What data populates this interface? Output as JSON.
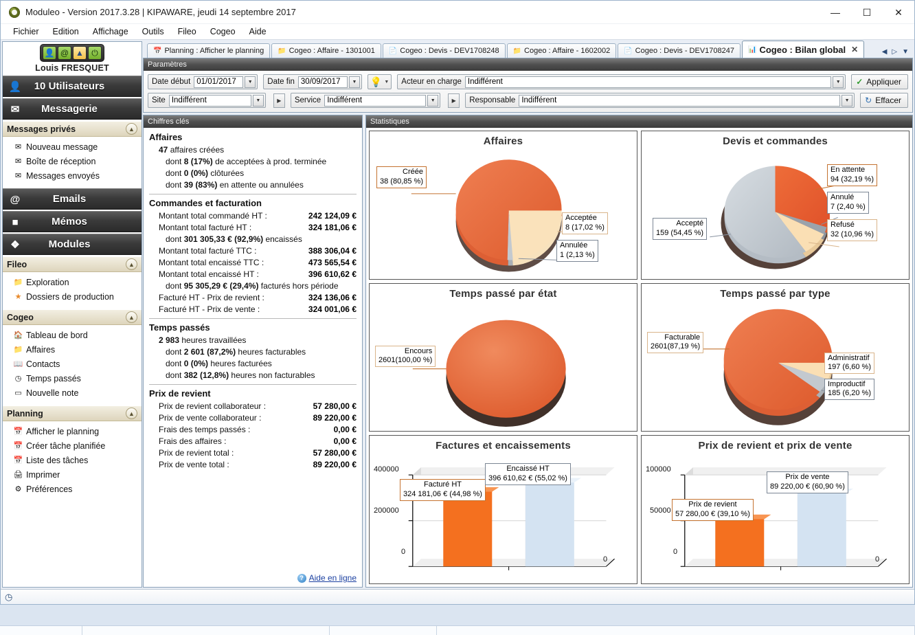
{
  "window": {
    "title": "Moduleo - Version 2017.3.28 | KIPAWARE, jeudi 14 septembre 2017",
    "minimize": "—",
    "maximize": "☐",
    "close": "✕"
  },
  "menu": [
    "Fichier",
    "Edition",
    "Affichage",
    "Outils",
    "Fileo",
    "Cogeo",
    "Aide"
  ],
  "sidebar": {
    "user_name": "Louis FRESQUET",
    "quick_icons": [
      "user-icon",
      "at-icon",
      "map-icon",
      "power-icon"
    ],
    "bars": [
      {
        "label": "10 Utilisateurs",
        "icon": "users-icon"
      },
      {
        "label": "Messagerie",
        "icon": "envelope-icon"
      },
      {
        "label": "Emails",
        "icon": "at-envelope-icon"
      },
      {
        "label": "Mémos",
        "icon": "note-icon"
      },
      {
        "label": "Modules",
        "icon": "modules-icon"
      }
    ],
    "groups": [
      {
        "title": "Messages privés",
        "items": [
          {
            "label": "Nouveau message",
            "icon": "new-message-icon"
          },
          {
            "label": "Boîte de réception",
            "icon": "inbox-icon"
          },
          {
            "label": "Messages envoyés",
            "icon": "sent-icon"
          }
        ]
      },
      {
        "title": "Fileo",
        "items": [
          {
            "label": "Exploration",
            "icon": "folder-explore-icon"
          },
          {
            "label": "Dossiers de production",
            "icon": "star-icon"
          }
        ]
      },
      {
        "title": "Cogeo",
        "items": [
          {
            "label": "Tableau de bord",
            "icon": "home-icon"
          },
          {
            "label": "Affaires",
            "icon": "folder-icon"
          },
          {
            "label": "Contacts",
            "icon": "contacts-icon"
          },
          {
            "label": "Temps passés",
            "icon": "clock-icon"
          },
          {
            "label": "Nouvelle note",
            "icon": "new-note-icon"
          }
        ]
      },
      {
        "title": "Planning",
        "items": [
          {
            "label": "Afficher le planning",
            "icon": "calendar-icon"
          },
          {
            "label": "Créer tâche planifiée",
            "icon": "calendar-add-icon"
          },
          {
            "label": "Liste des tâches",
            "icon": "calendar-list-icon"
          },
          {
            "label": "Imprimer",
            "icon": "printer-icon"
          },
          {
            "label": "Préférences",
            "icon": "preferences-icon"
          }
        ]
      }
    ]
  },
  "tabs": [
    {
      "label": "Planning : Afficher le planning",
      "icon": "calendar-icon",
      "active": false
    },
    {
      "label": "Cogeo : Affaire - 1301001",
      "icon": "folder-icon",
      "active": false
    },
    {
      "label": "Cogeo : Devis - DEV1708248",
      "icon": "doc-icon",
      "active": false
    },
    {
      "label": "Cogeo : Affaire - 1602002",
      "icon": "folder-icon",
      "active": false
    },
    {
      "label": "Cogeo : Devis - DEV1708247",
      "icon": "doc-icon",
      "active": false
    },
    {
      "label": "Cogeo : Bilan global",
      "icon": "chart-icon",
      "active": true
    }
  ],
  "tab_nav": {
    "prev": "◀",
    "next": "▷",
    "list": "▼",
    "close_active": "✕"
  },
  "params": {
    "panel_title": "Paramètres",
    "date_debut_label": "Date début",
    "date_debut_value": "01/01/2017",
    "date_fin_label": "Date fin",
    "date_fin_value": "30/09/2017",
    "bulb_icon": "lightbulb-icon",
    "acteur_label": "Acteur en charge",
    "acteur_value": "Indifférent",
    "site_label": "Site",
    "site_value": "Indifférent",
    "service_label": "Service",
    "service_value": "Indifférent",
    "responsable_label": "Responsable",
    "responsable_value": "Indifférent",
    "apply_label": "Appliquer",
    "clear_label": "Effacer"
  },
  "key_figures": {
    "panel_title": "Chiffres clés",
    "sections": [
      {
        "title": "Affaires",
        "lines": [
          {
            "label_bold": "47",
            "label_rest": " affaires créées",
            "indent": 0
          },
          {
            "label_pre": "dont ",
            "label_bold": "8 (17%)",
            "label_rest": " de  acceptées à prod. terminée",
            "indent": 1
          },
          {
            "label_pre": "dont ",
            "label_bold": "0 (0%)",
            "label_rest": " clôturées",
            "indent": 1
          },
          {
            "label_pre": "dont ",
            "label_bold": "39 (83%)",
            "label_rest": " en attente ou annulées",
            "indent": 1
          }
        ]
      },
      {
        "title": "Commandes et facturation",
        "lines": [
          {
            "label_rest": "Montant total commandé HT :",
            "value": "242 124,09 €",
            "indent": 0
          },
          {
            "label_rest": "Montant total facturé HT :",
            "value": "324 181,06 €",
            "indent": 0
          },
          {
            "label_pre": "dont ",
            "label_bold": "301 305,33 € (92,9%)",
            "label_rest": " encaissés",
            "indent": 1
          },
          {
            "label_rest": "Montant total facturé TTC :",
            "value": "388 306,04 €",
            "indent": 0
          },
          {
            "label_rest": "Montant total encaissé TTC :",
            "value": "473 565,54 €",
            "indent": 0
          },
          {
            "label_rest": "Montant total encaissé HT :",
            "value": "396 610,62 €",
            "indent": 0
          },
          {
            "label_pre": "dont ",
            "label_bold": "95 305,29 € (29,4%)",
            "label_rest": " facturés hors période",
            "indent": 1
          },
          {
            "label_rest": "Facturé HT - Prix de revient :",
            "value": "324 136,06 €",
            "indent": 0
          },
          {
            "label_rest": "Facturé HT - Prix de vente :",
            "value": "324 001,06 €",
            "indent": 0
          }
        ]
      },
      {
        "title": "Temps passés",
        "lines": [
          {
            "label_bold": "2 983",
            "label_rest": " heures travaillées",
            "indent": 0
          },
          {
            "label_pre": "dont ",
            "label_bold": "2 601 (87,2%)",
            "label_rest": " heures facturables",
            "indent": 1
          },
          {
            "label_pre": "dont ",
            "label_bold": "0 (0%)",
            "label_rest": " heures facturées",
            "indent": 1
          },
          {
            "label_pre": "dont ",
            "label_bold": "382 (12,8%)",
            "label_rest": " heures non facturables",
            "indent": 1
          }
        ]
      },
      {
        "title": "Prix de revient",
        "lines": [
          {
            "label_rest": "Prix de revient collaborateur :",
            "value": "57 280,00 €",
            "indent": 0
          },
          {
            "label_rest": "Prix de vente collaborateur :",
            "value": "89 220,00 €",
            "indent": 0
          },
          {
            "label_rest": "Frais des temps passés :",
            "value": "0,00 €",
            "indent": 0
          },
          {
            "label_rest": "Frais des affaires :",
            "value": "0,00 €",
            "indent": 0
          },
          {
            "label_rest": "Prix de revient total :",
            "value": "57 280,00 €",
            "indent": 0
          },
          {
            "label_rest": "Prix de vente total :",
            "value": "89 220,00 €",
            "indent": 0
          }
        ]
      }
    ],
    "help_link": "Aide en ligne",
    "help_icon": "help-icon"
  },
  "stats": {
    "panel_title": "Statistiques"
  },
  "colors": {
    "orange": "#e8663a",
    "orange_dark": "#d1532b",
    "peach": "#fadfb4",
    "grey": "#c3c9cf",
    "bar_orange": "#f4701f",
    "bar_blue": "#d4e3f2"
  },
  "chart_data": [
    {
      "type": "pie",
      "title": "Affaires",
      "labels": [
        "Créée",
        "Acceptée",
        "Annulée"
      ],
      "values": [
        38,
        8,
        1
      ],
      "percents": [
        "80,85 %",
        "17,02 %",
        "2,13 %"
      ],
      "display": [
        "38 (80,85 %)",
        "8 (17,02 %)",
        "1 (2,13 %)"
      ],
      "colors": [
        "#e8663a",
        "#fadfb4",
        "#c3c9cf"
      ],
      "legend": "callouts"
    },
    {
      "type": "pie",
      "title": "Devis et commandes",
      "labels": [
        "En attente",
        "Annulé",
        "Refusé",
        "Accepté"
      ],
      "values": [
        94,
        7,
        32,
        159
      ],
      "percents": [
        "32,19 %",
        "2,40 %",
        "10,96 %",
        "54,45 %"
      ],
      "display": [
        "94 (32,19 %)",
        "7 (2,40 %)",
        "32 (10,96 %)",
        "159 (54,45 %)"
      ],
      "colors": [
        "#e8663a",
        "#9aa3ac",
        "#fadfb4",
        "#c3c9cf"
      ],
      "legend": "callouts"
    },
    {
      "type": "pie",
      "title": "Temps passé par état",
      "labels": [
        "Encours"
      ],
      "values": [
        2601
      ],
      "percents": [
        "100,00 %"
      ],
      "display": [
        "2601(100,00 %)"
      ],
      "colors": [
        "#e8663a"
      ],
      "legend": "callouts"
    },
    {
      "type": "pie",
      "title": "Temps passé par type",
      "labels": [
        "Facturable",
        "Administratif",
        "Improductif"
      ],
      "values": [
        2601,
        197,
        185
      ],
      "percents": [
        "87,19 %",
        "6,60 %",
        "6,20 %"
      ],
      "display": [
        "2601(87,19 %)",
        "197 (6,60 %)",
        "185 (6,20 %)"
      ],
      "colors": [
        "#e8663a",
        "#fadfb4",
        "#c3c9cf"
      ],
      "legend": "callouts"
    },
    {
      "type": "bar",
      "title": "Factures et encaissements",
      "categories": [
        "Facturé HT",
        "Encaissé HT"
      ],
      "values": [
        324181.06,
        396610.62
      ],
      "display": [
        "324 181,06 € (44,98 %)",
        "396 610,62 € (55,02 %)"
      ],
      "percents": [
        "44,98 %",
        "55,02 %"
      ],
      "yticks": [
        "0",
        "200000",
        "400000"
      ],
      "ylim": [
        0,
        450000
      ],
      "xlabel": "0",
      "colors": [
        "#f4701f",
        "#d4e3f2"
      ]
    },
    {
      "type": "bar",
      "title": "Prix de revient et prix de vente",
      "categories": [
        "Prix de revient",
        "Prix de vente"
      ],
      "values": [
        57280.0,
        89220.0
      ],
      "display": [
        "57 280,00 € (39,10 %)",
        "89 220,00 € (60,90 %)"
      ],
      "percents": [
        "39,10 %",
        "60,90 %"
      ],
      "yticks": [
        "0",
        "50000",
        "100000"
      ],
      "ylim": [
        0,
        110000
      ],
      "xlabel": "0",
      "colors": [
        "#f4701f",
        "#d4e3f2"
      ]
    }
  ],
  "statusbar": {
    "clock_icon": "clock-icon"
  }
}
